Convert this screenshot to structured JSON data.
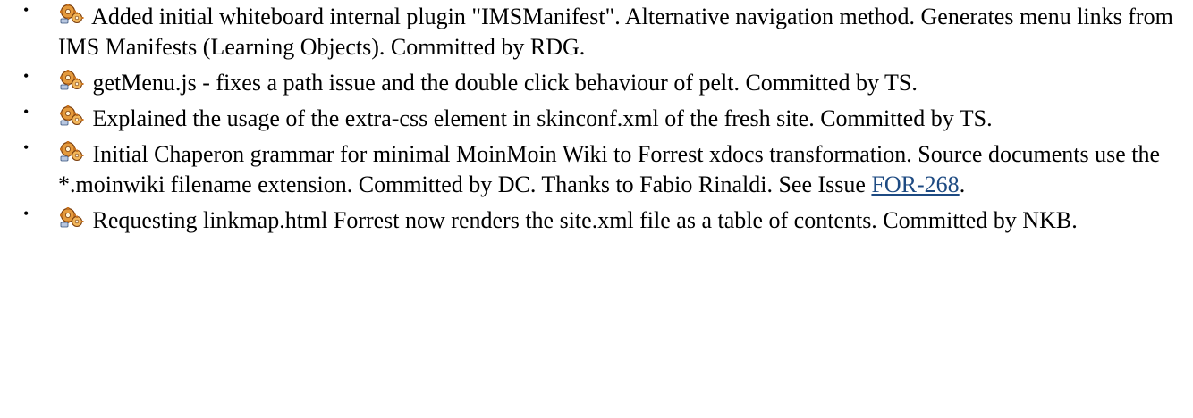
{
  "changes": [
    {
      "icon": "gears-icon",
      "text": "Added initial whiteboard internal plugin \"IMSManifest\". Alternative navigation method. Generates menu links from IMS Manifests (Learning Objects). Committed by RDG."
    },
    {
      "icon": "gears-icon",
      "text": "getMenu.js - fixes a path issue and the double click behaviour of pelt. Committed by TS."
    },
    {
      "icon": "gears-icon",
      "text": "Explained the usage of the extra-css element in skinconf.xml of the fresh site. Committed by TS."
    },
    {
      "icon": "gears-icon",
      "text": "Initial Chaperon grammar for minimal MoinMoin Wiki to Forrest xdocs transformation. Source documents use the *.moinwiki filename extension. Committed by DC. Thanks to Fabio Rinaldi. See Issue ",
      "link": "FOR-268",
      "suffix": "."
    },
    {
      "icon": "gears-icon",
      "text": "Requesting linkmap.html Forrest now renders the site.xml file as a table of contents. Committed by NKB."
    }
  ],
  "bullet": "•"
}
